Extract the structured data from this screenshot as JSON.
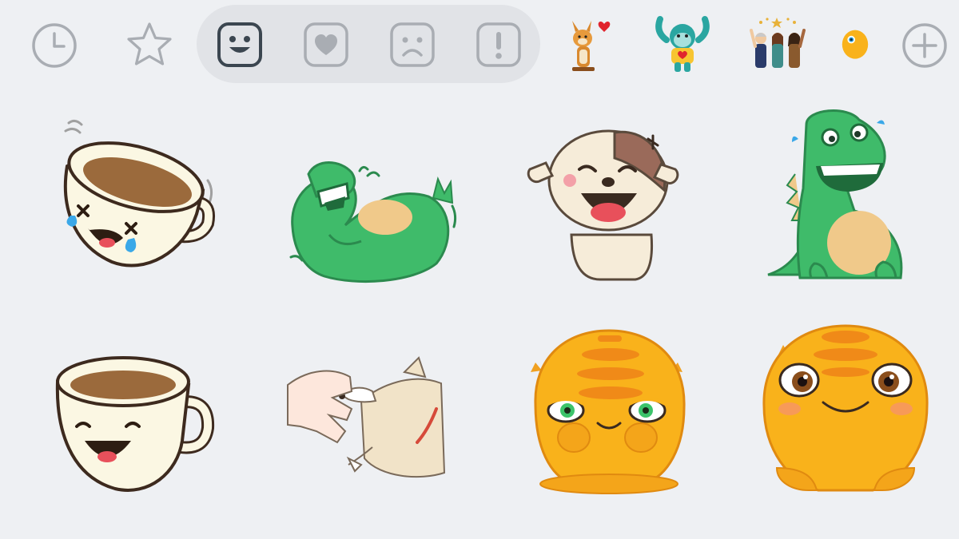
{
  "tabs": [
    {
      "name": "recent",
      "icon": "clock-icon",
      "selected": false
    },
    {
      "name": "favorites",
      "icon": "star-icon",
      "selected": false
    },
    {
      "name": "happy",
      "icon": "smiley-face-icon",
      "selected": true
    },
    {
      "name": "love",
      "icon": "heart-icon",
      "selected": false
    },
    {
      "name": "sad",
      "icon": "sad-face-icon",
      "selected": false
    },
    {
      "name": "exclamation",
      "icon": "exclamation-icon",
      "selected": false
    },
    {
      "name": "pack-dog-heart",
      "icon": "dog-with-heart-pack-icon"
    },
    {
      "name": "pack-monkey",
      "icon": "monkey-pack-icon"
    },
    {
      "name": "pack-people",
      "icon": "people-celebrating-pack-icon"
    },
    {
      "name": "pack-yellow-blob",
      "icon": "yellow-blob-pack-icon"
    },
    {
      "name": "add-pack",
      "icon": "plus-icon"
    }
  ],
  "colors": {
    "background": "#eef0f3",
    "pill": "#e1e3e7",
    "icon_inactive": "#a9adb3",
    "icon_selected": "#3b4650",
    "dino_green": "#3fbb6a",
    "blob_orange": "#f9b21b"
  },
  "stickers": [
    {
      "name": "teacup-laughing-crying",
      "row": 1
    },
    {
      "name": "green-dinosaur-rolling-laughing",
      "row": 1
    },
    {
      "name": "puppy-laughing",
      "row": 1
    },
    {
      "name": "green-dinosaur-laughing",
      "row": 1
    },
    {
      "name": "teacup-smiling",
      "row": 2
    },
    {
      "name": "hand-petting-dog",
      "row": 2
    },
    {
      "name": "yellow-blob-smirking",
      "row": 2
    },
    {
      "name": "yellow-blob-blushing",
      "row": 2
    }
  ]
}
